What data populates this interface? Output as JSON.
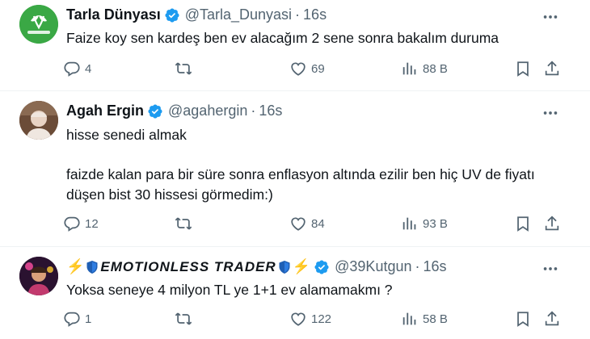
{
  "tweets": [
    {
      "name": "Tarla Dünyası",
      "handle": "@Tarla_Dunyasi",
      "time": "16s",
      "lines": [
        "Faize koy sen kardeş ben ev alacağım 2 sene sonra bakalım duruma"
      ],
      "replies": "4",
      "retweets": "",
      "likes": "69",
      "views": "88 B",
      "avatar_color": "#2e9e3e",
      "avatar_text": "TARLA DÜNYASI"
    },
    {
      "name": "Agah Ergin",
      "handle": "@agahergin",
      "time": "16s",
      "lines": [
        "hisse senedi almak",
        "",
        "faizde kalan para bir süre sonra enflasyon altında ezilir ben hiç UV de  fiyatı",
        "düşen bist 30 hissesi görmedim:)"
      ],
      "replies": "12",
      "retweets": "",
      "likes": "84",
      "views": "93 B"
    },
    {
      "name": "EMOTIONLESS TRADER",
      "handle": "@39Kutgun",
      "time": "16s",
      "lines": [
        "Yoksa seneye 4 milyon TL ye 1+1 ev alamamakmı ?"
      ],
      "replies": "1",
      "retweets": "",
      "likes": "122",
      "views": "58 B"
    }
  ],
  "colors": {
    "verified": "#1d9bf0",
    "muted": "#536471",
    "text": "#0f1419",
    "divider": "#eff3f4"
  },
  "icons": [
    "verified-badge-icon",
    "more-icon",
    "reply-icon",
    "retweet-icon",
    "like-icon",
    "views-icon",
    "bookmark-icon",
    "share-icon",
    "lightning-icon",
    "shield-icon"
  ]
}
